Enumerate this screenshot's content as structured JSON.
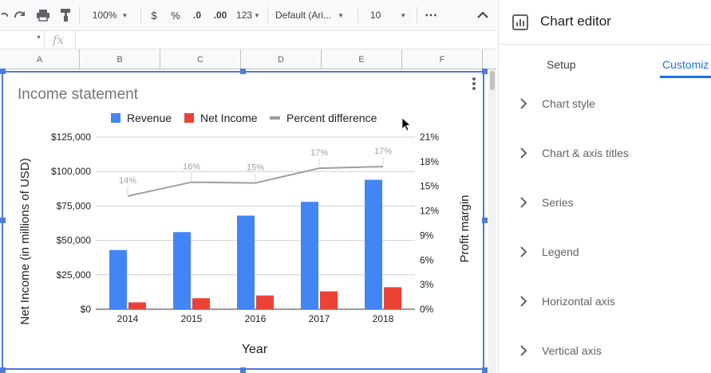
{
  "toolbar": {
    "zoom": "100%",
    "currency": "$",
    "percent": "%",
    "dec_decrease": ".0",
    "dec_increase": ".00",
    "more_formats": "123",
    "font": "Default (Ari...",
    "font_size": "10"
  },
  "columns": [
    "A",
    "B",
    "C",
    "D",
    "E",
    "F"
  ],
  "chart": {
    "title": "Income statement",
    "legend": [
      "Revenue",
      "Net Income",
      "Percent difference"
    ],
    "left_axis_title": "Net Income (in millions of USD)",
    "right_axis_title": "Profit margin",
    "x_axis_title": "Year",
    "left_ticks": [
      "$0",
      "$25,000",
      "$50,000",
      "$75,000",
      "$100,000",
      "$125,000"
    ],
    "right_ticks": [
      "0%",
      "3%",
      "6%",
      "9%",
      "12%",
      "15%",
      "18%",
      "21%"
    ],
    "colors": {
      "revenue": "#4285f4",
      "net_income": "#ea4335",
      "percent": "#9e9e9e"
    }
  },
  "chart_data": {
    "type": "bar",
    "title": "Income statement",
    "categories": [
      "2014",
      "2015",
      "2016",
      "2017",
      "2018"
    ],
    "xlabel": "Year",
    "ylabel": "Net Income (in millions of USD)",
    "ylim": [
      0,
      125000
    ],
    "y2label": "Profit margin",
    "y2lim": [
      0,
      21
    ],
    "legend_position": "top",
    "series": [
      {
        "name": "Revenue",
        "axis": "left",
        "type": "bar",
        "values": [
          43000,
          56000,
          68000,
          78000,
          94000
        ]
      },
      {
        "name": "Net Income",
        "axis": "left",
        "type": "bar",
        "values": [
          5000,
          8000,
          10000,
          13000,
          16000
        ]
      },
      {
        "name": "Percent difference",
        "axis": "right",
        "type": "line",
        "values": [
          13.8,
          15.5,
          15.4,
          17.2,
          17.4
        ],
        "labels": [
          "14%",
          "16%",
          "15%",
          "17%",
          "17%"
        ]
      }
    ]
  },
  "editor": {
    "title": "Chart editor",
    "tabs": [
      "Setup",
      "Customiz"
    ],
    "sections": [
      "Chart style",
      "Chart & axis titles",
      "Series",
      "Legend",
      "Horizontal axis",
      "Vertical axis"
    ]
  }
}
